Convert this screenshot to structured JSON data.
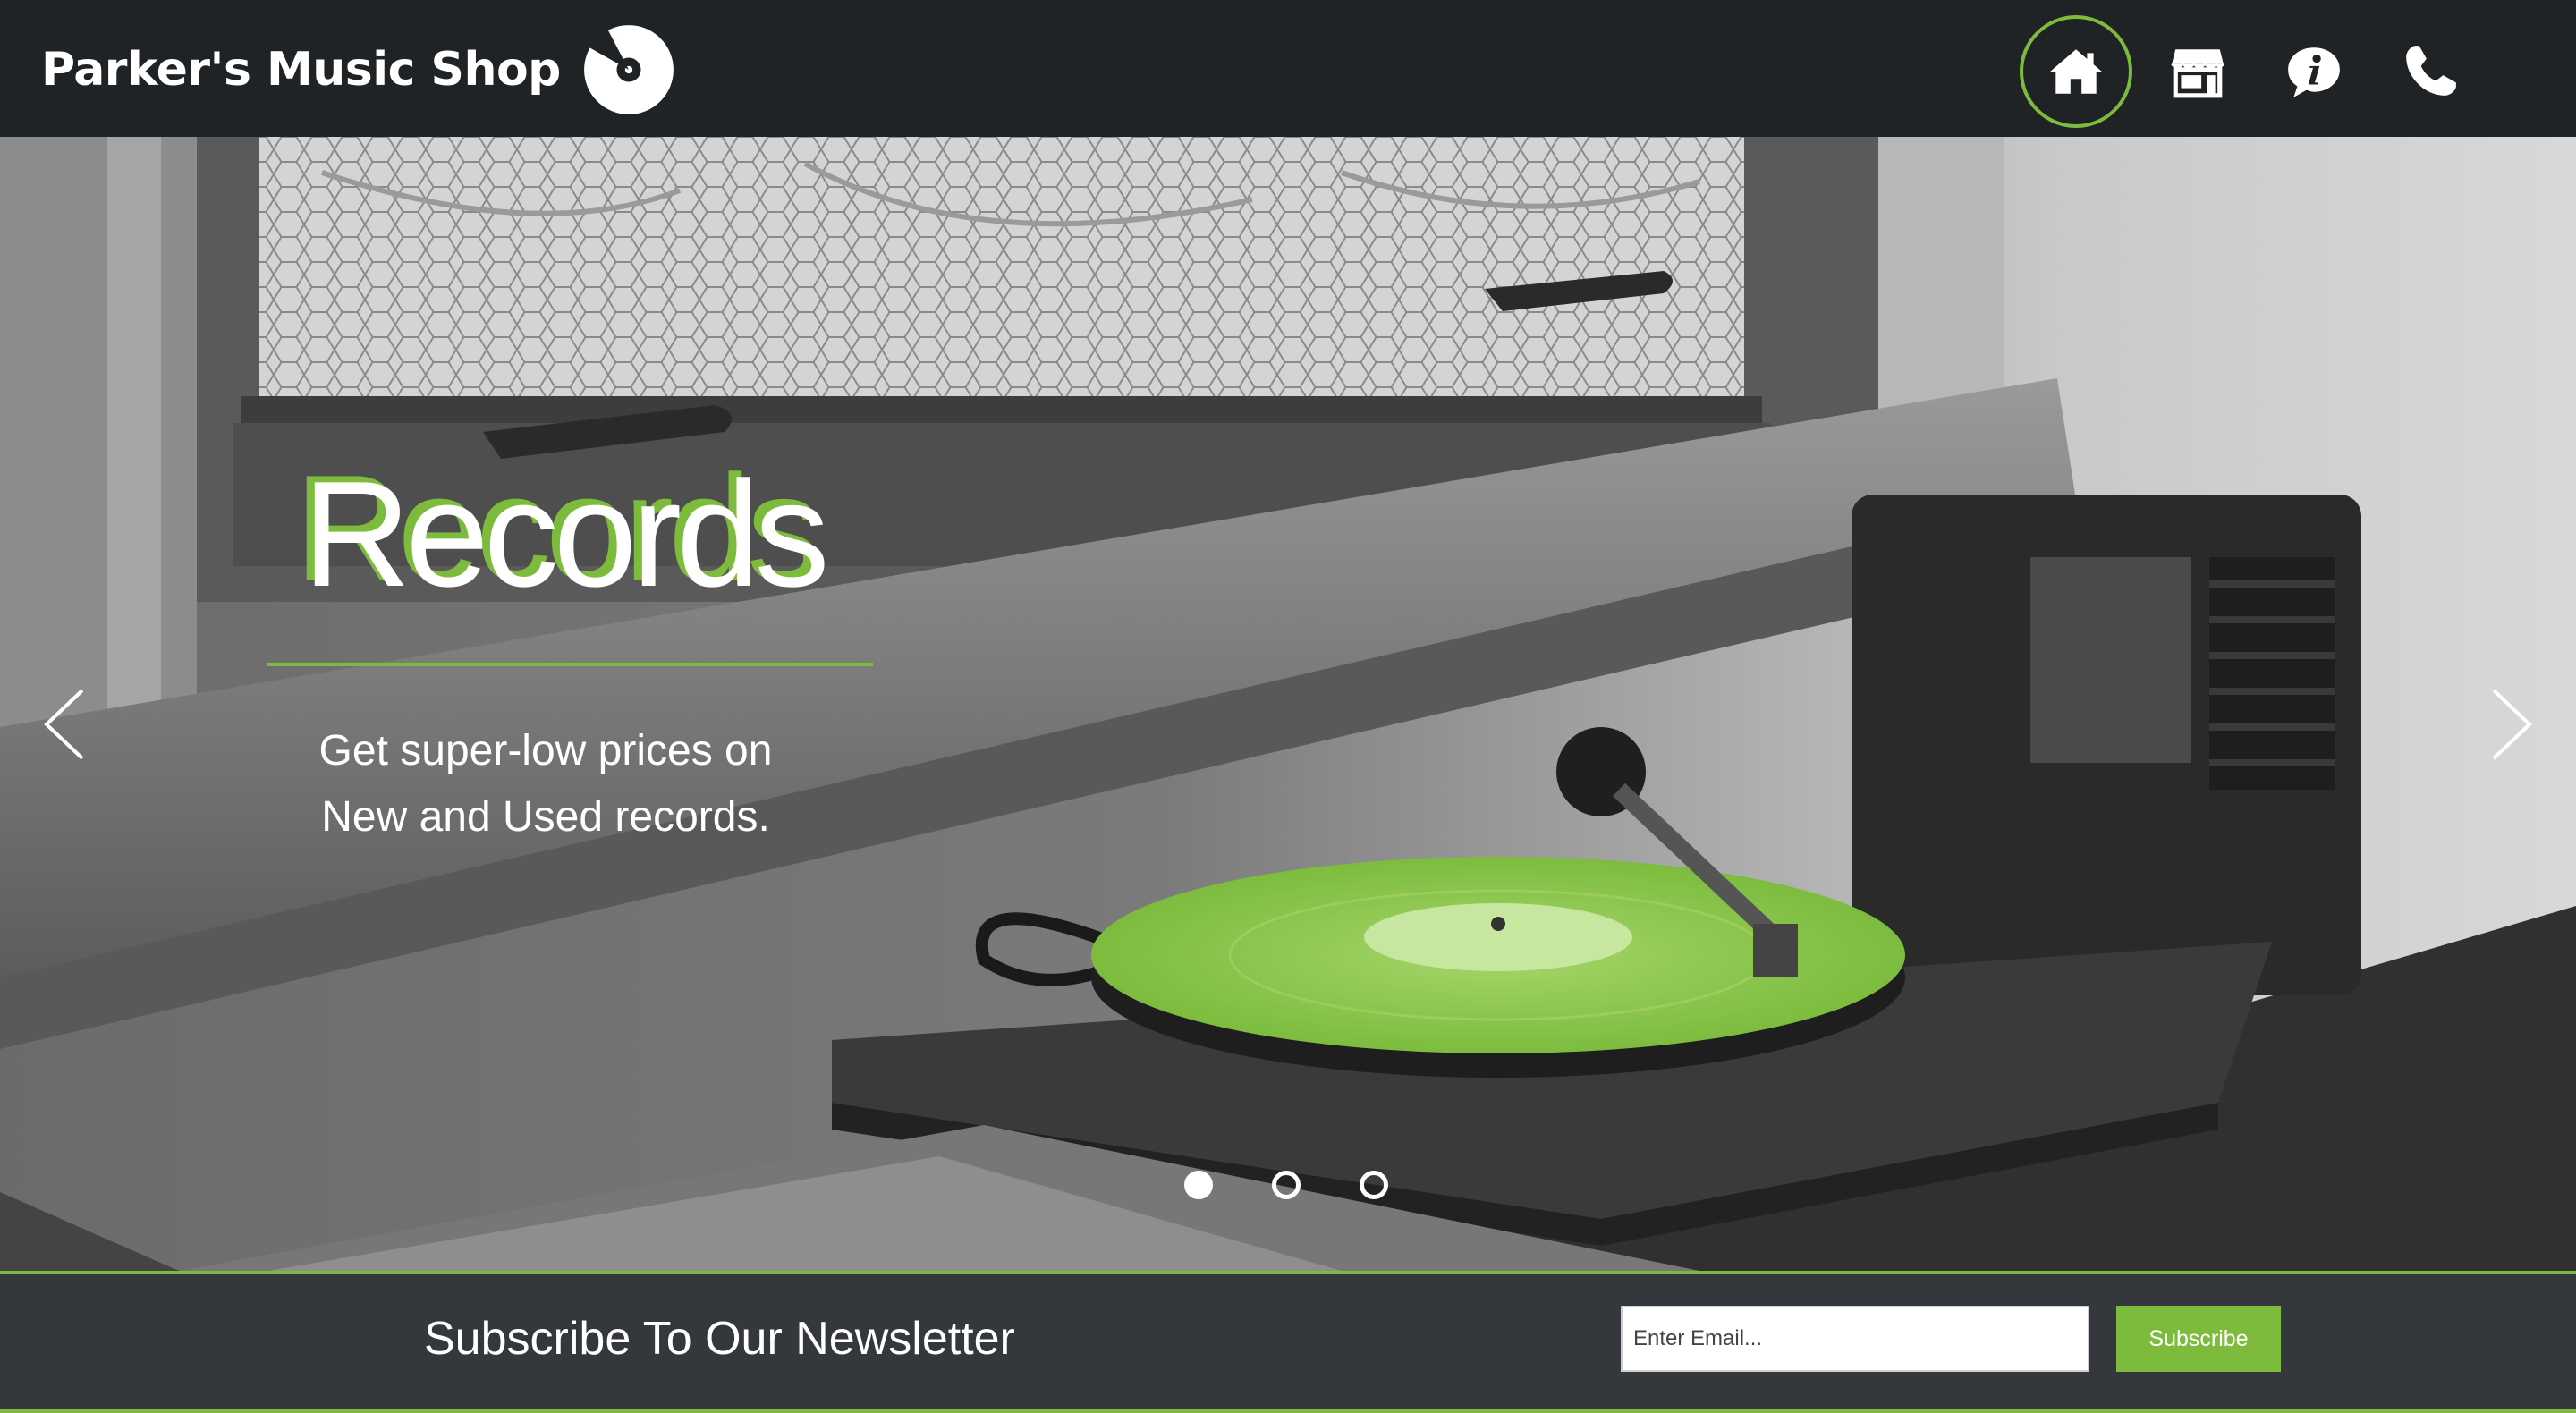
{
  "brand": {
    "name": "Parker's Music Shop",
    "logo_icon": "vinyl-record-icon"
  },
  "nav": {
    "items": [
      {
        "name": "home",
        "icon": "home-icon",
        "active": true
      },
      {
        "name": "store",
        "icon": "storefront-icon",
        "active": false
      },
      {
        "name": "info",
        "icon": "info-icon",
        "active": false
      },
      {
        "name": "contact",
        "icon": "phone-icon",
        "active": false
      }
    ]
  },
  "hero": {
    "title": "Records",
    "subtitle_line1": "Get super-low prices on",
    "subtitle_line2": "New and Used records.",
    "prev_icon": "chevron-left-icon",
    "next_icon": "chevron-right-icon",
    "slides_count": 3,
    "active_slide": 1
  },
  "newsletter": {
    "title": "Subscribe To Our Newsletter",
    "email_placeholder": "Enter Email...",
    "button_label": "Subscribe"
  },
  "colors": {
    "accent": "#7dbb3c",
    "header_bg": "#202326",
    "footer_bg": "#34383d"
  }
}
